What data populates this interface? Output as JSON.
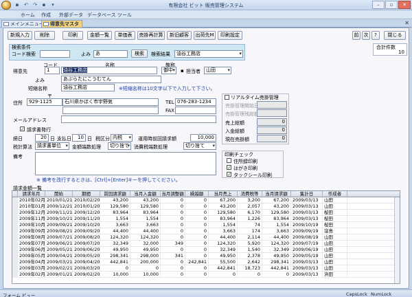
{
  "app": {
    "title": "有限会社 ビット 販売管理システム"
  },
  "qat": [
    "▪",
    "↶",
    "↷",
    "▪",
    "▾"
  ],
  "window": {
    "min": "–",
    "max": "▫",
    "close": "✕"
  },
  "menu": [
    "ホーム",
    "作成",
    "外部データ",
    "データベース ツール"
  ],
  "tabs": [
    {
      "label": "メインメニュー"
    },
    {
      "label": "得意先マスタ"
    }
  ],
  "toolbar": [
    "新規入力",
    "削除",
    "印刷",
    "金額一覧",
    "単価表",
    "売掛再計算",
    "新旧顧客",
    "出荷先M",
    "印刷設定"
  ],
  "nav": [
    "前",
    "次",
    "?",
    "閉じる"
  ],
  "search": {
    "header": "検索条件",
    "code_label": "コード検索",
    "code_value": "",
    "yomi_label": "よみ",
    "yomi_value": "あ",
    "btn": "検索",
    "result_label": "検索結果",
    "result_value": "油谷工務店"
  },
  "total": {
    "label": "合計件数",
    "value": "10"
  },
  "customer": {
    "section_label": "得意先",
    "code_hdr": "コード",
    "name_hdr": "名称",
    "keisho_hdr": "敬称",
    "code": "1",
    "name": "油谷工務店",
    "keisho": "御中",
    "tanto_label": "担当者",
    "tanto": "山田",
    "yomi_label": "よみ",
    "yomi": "あぶらたにこうむてん",
    "short_label": "短縮名称",
    "short": "油谷工務店",
    "short_note": "※短縮名称は10文字以下で入力して下さい。",
    "zip_hdr": "〒",
    "addr_label": "住所",
    "zip": "929-1125",
    "addr": "石川県かほく市宇野気",
    "tel_label": "TEL",
    "tel": "076-283-1234",
    "fax_label": "FAX",
    "fax": "",
    "mail_label": "メールアドレス",
    "mail": "",
    "invoice_label": "請求書発行",
    "invoice_checked": "✓",
    "close_label": "締日",
    "close_day": "20",
    "close_unit": "日",
    "pay_label": "支払日",
    "pay_day": "10",
    "pay_unit": "日",
    "tax_label": "税区分",
    "tax": "内税",
    "prev_label": "運用時前回請求額",
    "prev": "10,000",
    "taxcalc_label": "税計算法",
    "taxcalc": "請求書単位",
    "round_label": "金額端数処理",
    "round": "切り捨て",
    "cons_label": "消費税端数処理",
    "cons": "切り捨て",
    "memo_label": "備考",
    "memo_note": "※ 備考を改行するときは、[Ctrl]+[Enter]キーを押してください。"
  },
  "realtime": {
    "title": "リアルタイム売掛管理",
    "rows": [
      {
        "label": "売掛管理開始日",
        "value": ""
      },
      {
        "label": "売掛管理残総額",
        "value": ""
      },
      {
        "label": "売上総額",
        "value": "0"
      },
      {
        "label": "入金総額",
        "value": "0"
      },
      {
        "label": "現在売掛額",
        "value": "0"
      }
    ]
  },
  "print": {
    "title": "印刷チェック",
    "items": [
      {
        "label": "住所録印刷",
        "checked": ""
      },
      {
        "label": "はがき印刷",
        "checked": "✓"
      },
      {
        "label": "タックシール印刷",
        "checked": "✓"
      }
    ]
  },
  "grid": {
    "title": "請求金額一覧",
    "headers": [
      "請求年月",
      "開始",
      "期間",
      "前回請求額",
      "当月入金額",
      "当月調整額",
      "繰越額",
      "当月売上",
      "消費税等",
      "当月請求額",
      "集計日",
      "作成者"
    ],
    "rows": [
      [
        "2010年02月",
        "2010/01/21",
        "2010/02/20",
        "43,200",
        "43,200",
        "0",
        "0",
        "67,200",
        "3,200",
        "67,200",
        "2009/03/13",
        "山田"
      ],
      [
        "2010年01月",
        "2009/12/21",
        "2010/01/20",
        "129,580",
        "129,580",
        "0",
        "0",
        "43,200",
        "2,057",
        "43,200",
        "2009/03/13",
        "山田"
      ],
      [
        "2009年12月",
        "2009/11/21",
        "2009/12/20",
        "83,964",
        "83,964",
        "0",
        "0",
        "129,580",
        "6,170",
        "129,580",
        "2009/03/13",
        "桜田"
      ],
      [
        "2009年11月",
        "2009/10/21",
        "2009/11/20",
        "1,554",
        "1,554",
        "0",
        "0",
        "83,964",
        "1,226",
        "83,964",
        "2009/03/13",
        "桜田"
      ],
      [
        "2009年10月",
        "2009/09/21",
        "2009/10/20",
        "3,663",
        "3,663",
        "0",
        "0",
        "1,554",
        "74",
        "1,554",
        "2009/10/19",
        "桜田"
      ],
      [
        "2009年09月",
        "2009/08/21",
        "2009/09/20",
        "44,400",
        "44,400",
        "0",
        "0",
        "3,663",
        "174",
        "3,663",
        "2009/09/19",
        "窪島"
      ],
      [
        "2009年08月",
        "2009/07/21",
        "2009/08/20",
        "124,320",
        "124,320",
        "0",
        "0",
        "44,400",
        "2,114",
        "44,400",
        "2009/08/19",
        "山田"
      ],
      [
        "2009年07月",
        "2009/06/21",
        "2009/07/20",
        "32,349",
        "32,000",
        "349",
        "0",
        "124,320",
        "5,920",
        "124,320",
        "2009/07/19",
        "山田"
      ],
      [
        "2009年06月",
        "2009/05/21",
        "2009/06/20",
        "49,950",
        "49,950",
        "0",
        "0",
        "32,349",
        "1,540",
        "32,349",
        "2009/06/19",
        "山田"
      ],
      [
        "2009年05月",
        "2009/04/21",
        "2009/05/20",
        "298,341",
        "298,000",
        "341",
        "0",
        "49,950",
        "2,378",
        "49,950",
        "2009/05/19",
        "山田"
      ],
      [
        "2009年04月",
        "2009/03/21",
        "2009/04/20",
        "442,841",
        "200,000",
        "0",
        "242,841",
        "55,500",
        "2,642",
        "298,341",
        "2009/03/13",
        "山田"
      ],
      [
        "2009年03月",
        "2009/02/21",
        "2009/03/20",
        "0",
        "0",
        "0",
        "0",
        "442,841",
        "18,723",
        "442,841",
        "2009/03/13",
        "山田"
      ],
      [
        "2009年02月",
        "2009/01/21",
        "2009/02/20",
        "10,000",
        "10,000",
        "0",
        "0",
        "0",
        "0",
        "0",
        "2009/03/13",
        "浜田"
      ]
    ]
  },
  "status": {
    "left": "フォーム ビュー",
    "caps": "CapsLock",
    "num": "NumLock"
  }
}
